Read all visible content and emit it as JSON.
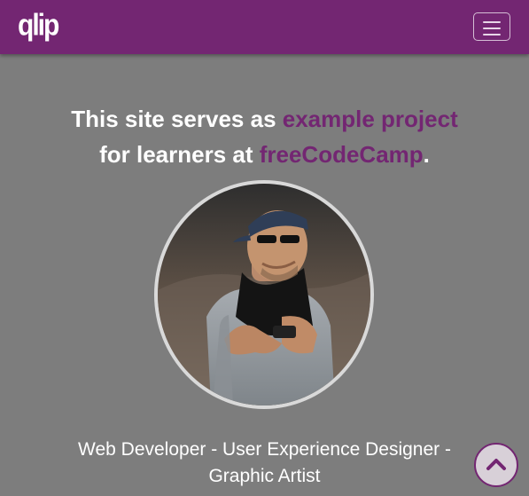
{
  "navbar": {
    "brand": "qlip",
    "menu_icon": "hamburger-menu-icon"
  },
  "intro": {
    "line1_prefix": "This site serves as ",
    "line1_highlight": "example project",
    "line2_prefix": "for learners at ",
    "line2_highlight": "freeCodeCamp",
    "line2_suffix": "."
  },
  "profile": {
    "tagline_line1": "Web Developer - User Experience Designer -",
    "tagline_line2": "Graphic Artist"
  },
  "scroll_top": {
    "icon": "chevron-up-icon"
  },
  "colors": {
    "brand": "#732672",
    "background": "#7d7d7d",
    "text": "#ffffff"
  }
}
